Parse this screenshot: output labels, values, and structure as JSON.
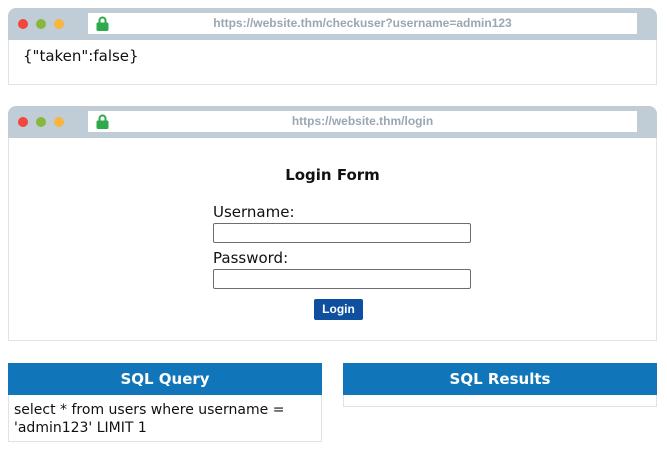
{
  "response_window": {
    "url": "https://website.thm/checkuser?username=admin123",
    "body_text": "{\"taken\":false}"
  },
  "login_window": {
    "url": "https://website.thm/login",
    "form_title": "Login Form",
    "username_label": "Username:",
    "username_value": "",
    "password_label": "Password:",
    "password_value": "",
    "login_button": "Login"
  },
  "sql_query": {
    "title": "SQL Query",
    "text": "select * from users where username = 'admin123' LIMIT 1"
  },
  "sql_results": {
    "title": "SQL Results",
    "text": ""
  },
  "colors": {
    "titlebar": "#c0ccd6",
    "panel_header": "#1075b9",
    "login_button": "#0f4f9f",
    "lock_icon": "#2eaa4a"
  },
  "icons": [
    "close-dot",
    "minimize-dot",
    "maximize-dot",
    "lock-icon"
  ]
}
